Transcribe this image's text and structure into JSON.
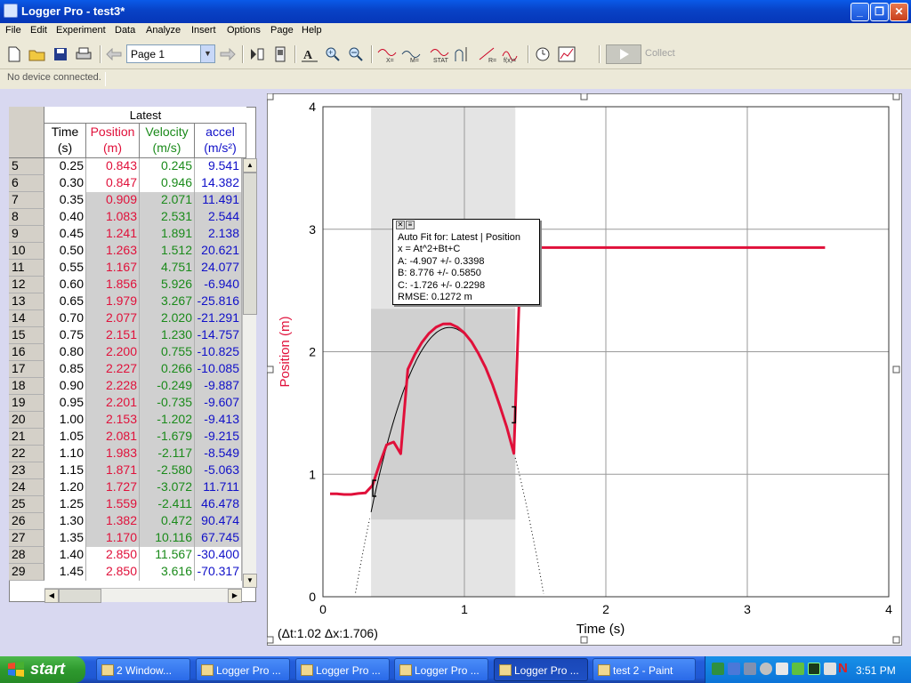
{
  "window": {
    "title": "Logger Pro - test3*"
  },
  "menu": [
    "File",
    "Edit",
    "Experiment",
    "Data",
    "Analyze",
    "Insert",
    "Options",
    "Page",
    "Help"
  ],
  "toolbar": {
    "page_select": "Page 1",
    "collect_label": "Collect"
  },
  "status": {
    "device": "No device connected."
  },
  "table": {
    "title": "Latest",
    "columns": [
      {
        "name": "Time",
        "unit": "(s)",
        "color": "#000000"
      },
      {
        "name": "Position",
        "unit": "(m)",
        "color": "#e0103a"
      },
      {
        "name": "Velocity",
        "unit": "(m/s)",
        "color": "#1a8a1a"
      },
      {
        "name": "accel",
        "unit": "(m/s²)",
        "color": "#1010c8"
      }
    ],
    "rows": [
      [
        "5",
        "0.25",
        "0.843",
        "0.245",
        "9.541"
      ],
      [
        "6",
        "0.30",
        "0.847",
        "0.946",
        "14.382"
      ],
      [
        "7",
        "0.35",
        "0.909",
        "2.071",
        "11.491"
      ],
      [
        "8",
        "0.40",
        "1.083",
        "2.531",
        "2.544"
      ],
      [
        "9",
        "0.45",
        "1.241",
        "1.891",
        "2.138"
      ],
      [
        "10",
        "0.50",
        "1.263",
        "1.512",
        "20.621"
      ],
      [
        "11",
        "0.55",
        "1.167",
        "4.751",
        "24.077"
      ],
      [
        "12",
        "0.60",
        "1.856",
        "5.926",
        "-6.940"
      ],
      [
        "13",
        "0.65",
        "1.979",
        "3.267",
        "-25.816"
      ],
      [
        "14",
        "0.70",
        "2.077",
        "2.020",
        "-21.291"
      ],
      [
        "15",
        "0.75",
        "2.151",
        "1.230",
        "-14.757"
      ],
      [
        "16",
        "0.80",
        "2.200",
        "0.755",
        "-10.825"
      ],
      [
        "17",
        "0.85",
        "2.227",
        "0.266",
        "-10.085"
      ],
      [
        "18",
        "0.90",
        "2.228",
        "-0.249",
        "-9.887"
      ],
      [
        "19",
        "0.95",
        "2.201",
        "-0.735",
        "-9.607"
      ],
      [
        "20",
        "1.00",
        "2.153",
        "-1.202",
        "-9.413"
      ],
      [
        "21",
        "1.05",
        "2.081",
        "-1.679",
        "-9.215"
      ],
      [
        "22",
        "1.10",
        "1.983",
        "-2.117",
        "-8.549"
      ],
      [
        "23",
        "1.15",
        "1.871",
        "-2.580",
        "-5.063"
      ],
      [
        "24",
        "1.20",
        "1.727",
        "-3.072",
        "11.711"
      ],
      [
        "25",
        "1.25",
        "1.559",
        "-2.411",
        "46.478"
      ],
      [
        "26",
        "1.30",
        "1.382",
        "0.472",
        "90.474"
      ],
      [
        "27",
        "1.35",
        "1.170",
        "10.116",
        "67.745"
      ],
      [
        "28",
        "1.40",
        "2.850",
        "11.567",
        "-30.400"
      ],
      [
        "29",
        "1.45",
        "2.850",
        "3.616",
        "-70.317"
      ]
    ],
    "selected_rows": [
      "7",
      "8",
      "9",
      "10",
      "11",
      "12",
      "13",
      "14",
      "15",
      "16",
      "17",
      "18",
      "19",
      "20",
      "21",
      "22",
      "23",
      "24",
      "25",
      "26",
      "27"
    ]
  },
  "graph": {
    "xlabel": "Time (s)",
    "ylabel": "Position (m)",
    "delta_readout": "(Δt:1.02 Δx:1.706)",
    "fit": {
      "title": "Auto Fit for: Latest | Position",
      "equation": "x = At^2+Bt+C",
      "a": "A: -4.907 +/- 0.3398",
      "b": "B: 8.776 +/- 0.5850",
      "c": "C: -1.726 +/- 0.2298",
      "rmse": "RMSE: 0.1272 m"
    },
    "colors": {
      "position": "#e0103a",
      "fit": "#000000",
      "selection": "#d8d8d8"
    }
  },
  "chart_data": {
    "type": "line",
    "xlabel": "Time (s)",
    "ylabel": "Position (m)",
    "xlim": [
      0,
      4
    ],
    "ylim": [
      0,
      4
    ],
    "x_ticks": [
      0,
      1,
      2,
      3,
      4
    ],
    "y_ticks": [
      0,
      1,
      2,
      3,
      4
    ],
    "grid": true,
    "selection_range": [
      0.34,
      1.36
    ],
    "series": [
      {
        "name": "Position",
        "x": [
          0.05,
          0.1,
          0.15,
          0.2,
          0.25,
          0.3,
          0.35,
          0.4,
          0.45,
          0.5,
          0.55,
          0.6,
          0.65,
          0.7,
          0.75,
          0.8,
          0.85,
          0.9,
          0.95,
          1.0,
          1.05,
          1.1,
          1.15,
          1.2,
          1.25,
          1.3,
          1.35,
          1.4,
          1.45,
          2.0,
          2.5,
          3.0,
          3.55
        ],
        "y": [
          0.84,
          0.84,
          0.835,
          0.835,
          0.843,
          0.847,
          0.909,
          1.083,
          1.241,
          1.263,
          1.167,
          1.856,
          1.979,
          2.077,
          2.151,
          2.2,
          2.227,
          2.228,
          2.201,
          2.153,
          2.081,
          1.983,
          1.871,
          1.727,
          1.559,
          1.382,
          1.17,
          2.85,
          2.85,
          2.85,
          2.85,
          2.85,
          2.85
        ]
      }
    ],
    "fit": {
      "a": -4.907,
      "b": 8.776,
      "c": -1.726
    }
  },
  "taskbar": {
    "start": "start",
    "tasks": [
      "2 Window...",
      "Logger Pro ...",
      "Logger Pro ...",
      "Logger Pro ...",
      "Logger Pro ...",
      "test 2 - Paint"
    ],
    "active_task": 4,
    "clock": "3:51 PM"
  }
}
